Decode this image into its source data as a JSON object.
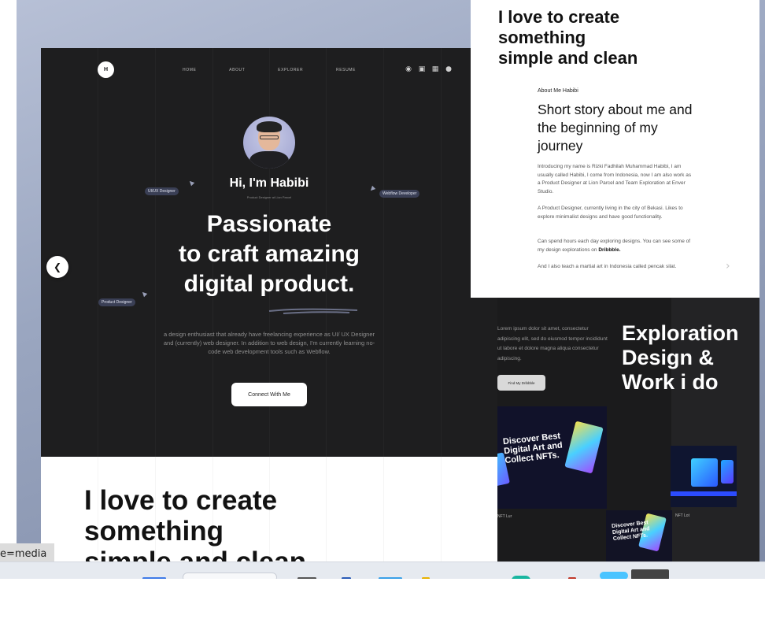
{
  "hero": {
    "logo": "H",
    "nav": [
      "HOME",
      "ABOUT",
      "EXPLORER",
      "RESUME"
    ],
    "socials": [
      "dribbble-icon",
      "instagram-icon",
      "linkedin-icon",
      "medium-icon"
    ],
    "name": "Hi, I'm Habibi",
    "role": "Product Designer at Lion Parcel",
    "tags": [
      "UI/UX Designer",
      "Webflow Developer",
      "Product Designer"
    ],
    "headline": [
      "Passionate",
      "to craft amazing",
      "digital product."
    ],
    "intro": "a design enthusiast that already have freelancing experience as UI/ UX Designer and (currently) web designer. In addition to web design, I'm currently learning no-code web development tools such as Webflow.",
    "cta": "Connect With Me"
  },
  "bottom": {
    "heading": [
      "I love to create",
      "something",
      "simple and clean"
    ]
  },
  "about": {
    "top_heading": [
      "I love to create",
      "something",
      "simple and clean"
    ],
    "kicker": "About Me Habibi",
    "title": "Short story about me and the beginning of my journey",
    "p1": "Introducing my name is Rizki Fadhilah Muhammad Habibi, I am usually called Habibi, I come from Indonesia, now I am also work as a Product Designer at Lion Parcel and Team Exploration at Enver Studio.",
    "p2": "A Product Designer, currently living in the city of Bekasi. Likes to explore minimalist designs and have good functionality.",
    "p3_pre": "Can spend hours each day exploring designs. You can see some of my design explorations on ",
    "p3_bold": "Dribbble.",
    "p4": "And I also teach a martial art in Indonesia called pencak silat."
  },
  "explore": {
    "lorem": "Lorem ipsum dolor sit amet, consectetur adipiscing elit, sed do eiusmod tempor incididunt ut labore et dolore magna aliqua consectetur adipiscing.",
    "button": "Find My Dribbble",
    "title": [
      "Exploration",
      "Design &",
      "Work i do"
    ],
    "shot1_heading": "Discover Best Digital Art and Collect NFTs.",
    "shot2_heading": "Discover Best Digital Art and Collect NFTs.",
    "shot_label_1": "NFT Lur",
    "shot_label_2": "NFT Lot"
  },
  "viewer": {
    "prev_icon": "chevron-left-icon",
    "next_icon": "chevron-right-icon",
    "url_hint": "e=media"
  },
  "colors": {
    "backdrop": "#9aa6c0",
    "hero_bg": "#1e1e1f",
    "tag_bg": "#3a3f55",
    "explore_bg": "#1b1b1c"
  }
}
